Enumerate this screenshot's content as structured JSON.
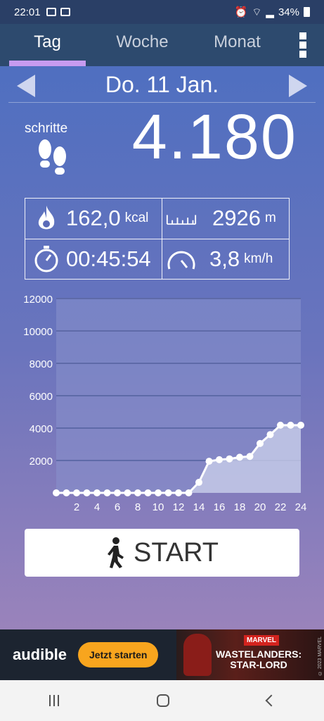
{
  "status_bar": {
    "time": "22:01",
    "battery": "34%",
    "left_icons": [
      "gallery-icon",
      "smile-icon"
    ],
    "right_icons": [
      "alarm-icon",
      "clock-icon",
      "wifi-icon",
      "signal-icon",
      "battery-icon"
    ]
  },
  "tabs": [
    {
      "label": "Tag",
      "active": true
    },
    {
      "label": "Woche",
      "active": false
    },
    {
      "label": "Monat",
      "active": false
    }
  ],
  "date": "Do. 11 Jan.",
  "steps": {
    "label": "schritte",
    "value": "4.180"
  },
  "stats": {
    "calories": {
      "value": "162,0",
      "unit": "kcal"
    },
    "distance": {
      "value": "2926",
      "unit": "m"
    },
    "duration": {
      "value": "00:45:54"
    },
    "speed": {
      "value": "3,8",
      "unit": "km/h"
    }
  },
  "chart_data": {
    "type": "area",
    "x": [
      0,
      1,
      2,
      3,
      4,
      5,
      6,
      7,
      8,
      9,
      10,
      11,
      12,
      13,
      14,
      15,
      16,
      17,
      18,
      19,
      20,
      21,
      22,
      23,
      24
    ],
    "values": [
      0,
      0,
      0,
      0,
      0,
      0,
      0,
      0,
      0,
      0,
      0,
      0,
      0,
      0,
      650,
      1950,
      2050,
      2100,
      2200,
      2250,
      3050,
      3600,
      4180,
      4180,
      4180
    ],
    "ylim": [
      0,
      12000
    ],
    "xlim": [
      0,
      24
    ],
    "y_ticks": [
      2000,
      4000,
      6000,
      8000,
      10000,
      12000
    ],
    "x_ticks": [
      2,
      4,
      6,
      8,
      10,
      12,
      14,
      16,
      18,
      20,
      22,
      24
    ],
    "grid": true,
    "colors": {
      "line": "#ffffff",
      "fill": "#c8cde8",
      "grid": "#5e6aa8"
    }
  },
  "start_button": {
    "label": "START"
  },
  "ad": {
    "brand": "audible",
    "cta": "Jetzt starten",
    "marvel": "MARVEL",
    "title_line1": "WASTELANDERS:",
    "title_line2": "STAR-LORD",
    "copyright": "© 2023 MARVEL"
  }
}
